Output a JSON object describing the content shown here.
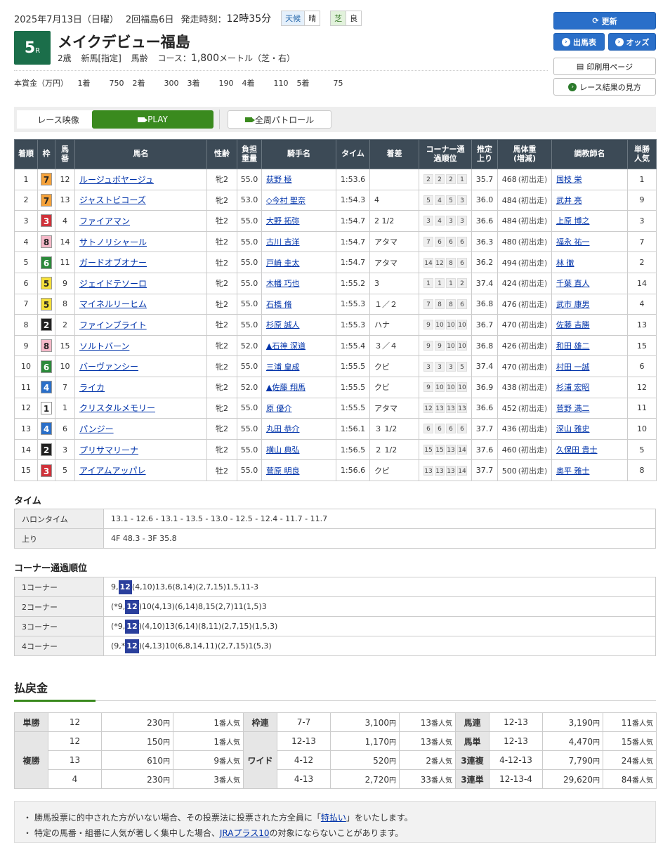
{
  "header": {
    "date": "2025年7月13日（日曜）",
    "meet": "2回福島6日",
    "post_time_label": "発走時刻：",
    "post_time": "12時35分",
    "weather_label": "天候",
    "weather": "晴",
    "track_label": "芝",
    "track_cond": "良",
    "race_no": "5",
    "race_suffix": "R",
    "race_name": "メイクデビュー福島",
    "age": "2歳",
    "class": "新馬[指定]",
    "weight_rule": "馬齢",
    "course_label": "コース：",
    "distance": "1,800",
    "distance_unit": "メートル（芝・右）",
    "prize_label": "本賞金（万円）",
    "prizes": [
      {
        "place": "1着",
        "value": "750"
      },
      {
        "place": "2着",
        "value": "300"
      },
      {
        "place": "3着",
        "value": "190"
      },
      {
        "place": "4着",
        "value": "110"
      },
      {
        "place": "5着",
        "value": "75"
      }
    ]
  },
  "buttons": {
    "refresh": "更新",
    "entries": "出馬表",
    "odds": "オッズ",
    "print": "印刷用ページ",
    "howto": "レース結果の見方"
  },
  "video": {
    "label": "レース映像",
    "play": "PLAY",
    "patrol": "全周パトロール"
  },
  "table_headers": {
    "rank": "着順",
    "waku": "枠",
    "num": "馬番",
    "horse": "馬名",
    "sexage": "性齢",
    "weight": "負担重量",
    "jockey": "騎手名",
    "time": "タイム",
    "margin": "着差",
    "corner": "コーナー通過順位",
    "last3f": "推定上り",
    "bodyweight": "馬体重(増減)",
    "trainer": "調教師名",
    "pop": "単勝人気"
  },
  "results": [
    {
      "rank": "1",
      "waku": "7",
      "num": "12",
      "horse": "ルージュボヤージュ",
      "sexage": "牝2",
      "weight": "55.0",
      "jockey": "荻野 極",
      "time": "1:53.6",
      "margin": "",
      "corners": [
        "2",
        "2",
        "2",
        "1"
      ],
      "last3f": "35.7",
      "bw": "468",
      "bwd": "(初出走)",
      "trainer": "国枝 栄",
      "pop": "1"
    },
    {
      "rank": "2",
      "waku": "7",
      "num": "13",
      "horse": "ジャストビコーズ",
      "sexage": "牝2",
      "weight": "53.0",
      "jockey": "◇今村 聖奈",
      "time": "1:54.3",
      "margin": "4",
      "corners": [
        "5",
        "4",
        "5",
        "3"
      ],
      "last3f": "36.0",
      "bw": "484",
      "bwd": "(初出走)",
      "trainer": "武井 亮",
      "pop": "9"
    },
    {
      "rank": "3",
      "waku": "3",
      "num": "4",
      "horse": "ファイアマン",
      "sexage": "牡2",
      "weight": "55.0",
      "jockey": "大野 拓弥",
      "time": "1:54.7",
      "margin": "2 1/2",
      "corners": [
        "3",
        "4",
        "3",
        "3"
      ],
      "last3f": "36.6",
      "bw": "484",
      "bwd": "(初出走)",
      "trainer": "上原 博之",
      "pop": "3"
    },
    {
      "rank": "4",
      "waku": "8",
      "num": "14",
      "horse": "サトノリシャール",
      "sexage": "牡2",
      "weight": "55.0",
      "jockey": "古川 吉洋",
      "time": "1:54.7",
      "margin": "アタマ",
      "corners": [
        "7",
        "6",
        "6",
        "6"
      ],
      "last3f": "36.3",
      "bw": "480",
      "bwd": "(初出走)",
      "trainer": "福永 祐一",
      "pop": "7"
    },
    {
      "rank": "5",
      "waku": "6",
      "num": "11",
      "horse": "ガードオブオナー",
      "sexage": "牡2",
      "weight": "55.0",
      "jockey": "戸崎 圭太",
      "time": "1:54.7",
      "margin": "アタマ",
      "corners": [
        "14",
        "12",
        "8",
        "6"
      ],
      "last3f": "36.2",
      "bw": "494",
      "bwd": "(初出走)",
      "trainer": "林 徹",
      "pop": "2"
    },
    {
      "rank": "6",
      "waku": "5",
      "num": "9",
      "horse": "ジェイドテソーロ",
      "sexage": "牝2",
      "weight": "55.0",
      "jockey": "木幡 巧也",
      "time": "1:55.2",
      "margin": "3",
      "corners": [
        "1",
        "1",
        "1",
        "2"
      ],
      "last3f": "37.4",
      "bw": "424",
      "bwd": "(初出走)",
      "trainer": "千葉 直人",
      "pop": "14"
    },
    {
      "rank": "7",
      "waku": "5",
      "num": "8",
      "horse": "マイネルリーヒム",
      "sexage": "牡2",
      "weight": "55.0",
      "jockey": "石橋 脩",
      "time": "1:55.3",
      "margin": "１／２",
      "corners": [
        "7",
        "8",
        "8",
        "6"
      ],
      "last3f": "36.8",
      "bw": "476",
      "bwd": "(初出走)",
      "trainer": "武市 康男",
      "pop": "4"
    },
    {
      "rank": "8",
      "waku": "2",
      "num": "2",
      "horse": "ファインブライト",
      "sexage": "牡2",
      "weight": "55.0",
      "jockey": "杉原 誠人",
      "time": "1:55.3",
      "margin": "ハナ",
      "corners": [
        "9",
        "10",
        "10",
        "10"
      ],
      "last3f": "36.7",
      "bw": "470",
      "bwd": "(初出走)",
      "trainer": "佐藤 吉勝",
      "pop": "13"
    },
    {
      "rank": "9",
      "waku": "8",
      "num": "15",
      "horse": "ソルトバーン",
      "sexage": "牝2",
      "weight": "52.0",
      "jockey": "▲石神 深道",
      "time": "1:55.4",
      "margin": "３／４",
      "corners": [
        "9",
        "9",
        "10",
        "10"
      ],
      "last3f": "36.8",
      "bw": "426",
      "bwd": "(初出走)",
      "trainer": "和田 雄二",
      "pop": "15"
    },
    {
      "rank": "10",
      "waku": "6",
      "num": "10",
      "horse": "バーヴァンシー",
      "sexage": "牝2",
      "weight": "55.0",
      "jockey": "三浦 皇成",
      "time": "1:55.5",
      "margin": "クビ",
      "corners": [
        "3",
        "3",
        "3",
        "5"
      ],
      "last3f": "37.4",
      "bw": "470",
      "bwd": "(初出走)",
      "trainer": "村田 一誠",
      "pop": "6"
    },
    {
      "rank": "11",
      "waku": "4",
      "num": "7",
      "horse": "ライカ",
      "sexage": "牝2",
      "weight": "52.0",
      "jockey": "▲佐藤 翔馬",
      "time": "1:55.5",
      "margin": "クビ",
      "corners": [
        "9",
        "10",
        "10",
        "10"
      ],
      "last3f": "36.9",
      "bw": "438",
      "bwd": "(初出走)",
      "trainer": "杉浦 宏昭",
      "pop": "12"
    },
    {
      "rank": "12",
      "waku": "1",
      "num": "1",
      "horse": "クリスタルメモリー",
      "sexage": "牝2",
      "weight": "55.0",
      "jockey": "原 優介",
      "time": "1:55.5",
      "margin": "アタマ",
      "corners": [
        "12",
        "13",
        "13",
        "13"
      ],
      "last3f": "36.6",
      "bw": "452",
      "bwd": "(初出走)",
      "trainer": "菅野 満二",
      "pop": "11"
    },
    {
      "rank": "13",
      "waku": "4",
      "num": "6",
      "horse": "パンジー",
      "sexage": "牝2",
      "weight": "55.0",
      "jockey": "丸田 恭介",
      "time": "1:56.1",
      "margin": "３ 1/2",
      "corners": [
        "6",
        "6",
        "6",
        "6"
      ],
      "last3f": "37.7",
      "bw": "436",
      "bwd": "(初出走)",
      "trainer": "深山 雅史",
      "pop": "10"
    },
    {
      "rank": "14",
      "waku": "2",
      "num": "3",
      "horse": "プリサマリーナ",
      "sexage": "牝2",
      "weight": "55.0",
      "jockey": "横山 典弘",
      "time": "1:56.5",
      "margin": "２ 1/2",
      "corners": [
        "15",
        "15",
        "13",
        "14"
      ],
      "last3f": "37.6",
      "bw": "460",
      "bwd": "(初出走)",
      "trainer": "久保田 貴士",
      "pop": "5"
    },
    {
      "rank": "15",
      "waku": "3",
      "num": "5",
      "horse": "アイアムアッパレ",
      "sexage": "牡2",
      "weight": "55.0",
      "jockey": "菅原 明良",
      "time": "1:56.6",
      "margin": "クビ",
      "corners": [
        "13",
        "13",
        "13",
        "14"
      ],
      "last3f": "37.7",
      "bw": "500",
      "bwd": "(初出走)",
      "trainer": "奥平 雅士",
      "pop": "8"
    }
  ],
  "waku_colors": {
    "1": {
      "bg": "#ffffff",
      "fg": "#222222"
    },
    "2": {
      "bg": "#222222",
      "fg": "#ffffff"
    },
    "3": {
      "bg": "#d0313a",
      "fg": "#ffffff"
    },
    "4": {
      "bg": "#2a6fc9",
      "fg": "#ffffff"
    },
    "5": {
      "bg": "#f5e03a",
      "fg": "#222222"
    },
    "6": {
      "bg": "#2b8a3a",
      "fg": "#ffffff"
    },
    "7": {
      "bg": "#f5a23a",
      "fg": "#222222"
    },
    "8": {
      "bg": "#f5b8c8",
      "fg": "#222222"
    }
  },
  "time_section": {
    "title": "タイム",
    "furlong_label": "ハロンタイム",
    "furlong": "13.1 - 12.6 - 13.1 - 13.5 - 13.0 - 12.5 - 12.4 - 11.7 - 11.7",
    "agari_label": "上り",
    "agari": "4F 48.3 - 3F 35.8"
  },
  "corner_section": {
    "title": "コーナー通過順位",
    "rows": [
      {
        "label": "1コーナー",
        "pre": "9,",
        "hl": "12",
        "post": "(4,10)13,6(8,14)(2,7,15)1,5,11-3"
      },
      {
        "label": "2コーナー",
        "pre": "(*9,",
        "hl": "12",
        "post": ")10(4,13)(6,14)8,15(2,7)11(1,5)3"
      },
      {
        "label": "3コーナー",
        "pre": "(*9,",
        "hl": "12",
        "post": ")(4,10)13(6,14)(8,11)(2,7,15)(1,5,3)"
      },
      {
        "label": "4コーナー",
        "pre": "(9,*",
        "hl": "12",
        "post": ")(4,13)10(6,8,14,11)(2,7,15)1(5,3)"
      }
    ]
  },
  "payout": {
    "title": "払戻金",
    "yen": "円",
    "pop_suffix": "番人気",
    "tansho": {
      "label": "単勝",
      "num": "12",
      "amt": "230",
      "pop": "1"
    },
    "fukusho": {
      "label": "複勝",
      "rows": [
        {
          "num": "12",
          "amt": "150",
          "pop": "1"
        },
        {
          "num": "13",
          "amt": "610",
          "pop": "9"
        },
        {
          "num": "4",
          "amt": "230",
          "pop": "3"
        }
      ]
    },
    "wakuren": {
      "label": "枠連",
      "num": "7-7",
      "amt": "3,100",
      "pop": "13"
    },
    "wide": {
      "label": "ワイド",
      "rows": [
        {
          "num": "12-13",
          "amt": "1,170",
          "pop": "13"
        },
        {
          "num": "4-12",
          "amt": "520",
          "pop": "2"
        },
        {
          "num": "4-13",
          "amt": "2,720",
          "pop": "33"
        }
      ]
    },
    "umaren": {
      "label": "馬連",
      "num": "12-13",
      "amt": "3,190",
      "pop": "11"
    },
    "umatan": {
      "label": "馬単",
      "num": "12-13",
      "amt": "4,470",
      "pop": "15"
    },
    "sanrenpuku": {
      "label": "3連複",
      "num": "4-12-13",
      "amt": "7,790",
      "pop": "24"
    },
    "sanrentan": {
      "label": "3連単",
      "num": "12-13-4",
      "amt": "29,620",
      "pop": "84"
    }
  },
  "notes": {
    "n1_pre": "・ 勝馬投票に的中された方がいない場合、その投票法に投票された方全員に「",
    "n1_link": "特払い",
    "n1_post": "」をいたします。",
    "n2_pre": "・ 特定の馬番・組番に人気が著しく集中した場合、",
    "n2_link": "JRAプラス10",
    "n2_post": "の対象にならないことがあります。"
  }
}
